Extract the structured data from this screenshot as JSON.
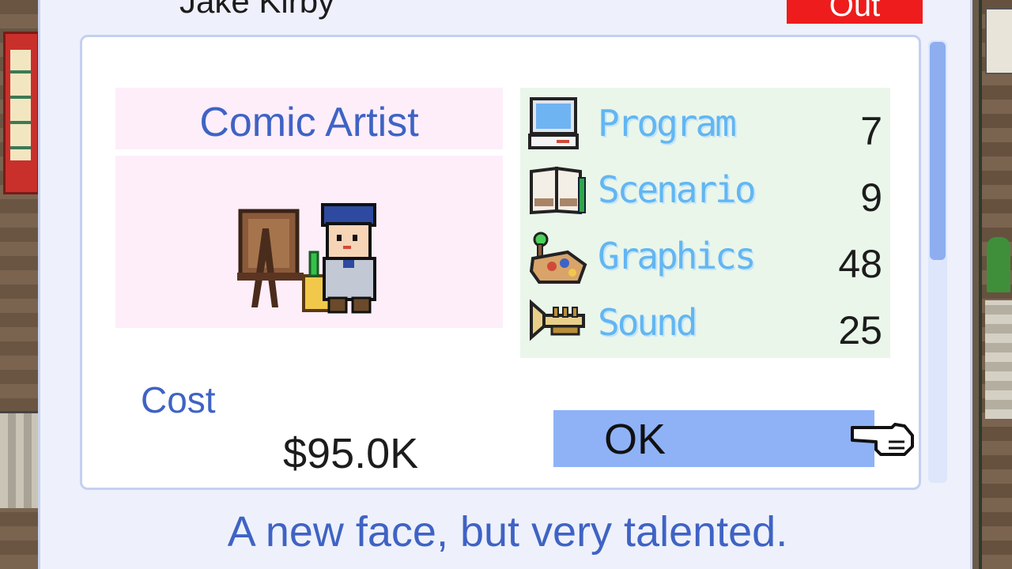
{
  "employee": {
    "name": "Jake Kirby",
    "out_label": "Out"
  },
  "job": {
    "title": "Comic Artist",
    "portrait": "comic-artist-sprite"
  },
  "stats": [
    {
      "label": "Program",
      "value": "7",
      "icon": "computer-icon"
    },
    {
      "label": "Scenario",
      "value": "9",
      "icon": "book-icon"
    },
    {
      "label": "Graphics",
      "value": "48",
      "icon": "palette-icon"
    },
    {
      "label": "Sound",
      "value": "25",
      "icon": "trumpet-icon"
    }
  ],
  "cost": {
    "label": "Cost",
    "value": "$95.0K"
  },
  "ok_label": "OK",
  "message": "A new face, but very talented.",
  "colors": {
    "out": "#ee1c1c",
    "ok": "#8fb2f7",
    "accent_text": "#3f63c4",
    "stat_label": "#62b6f2",
    "portrait_bg": "#fdeefa",
    "stats_bg": "#eaf6ea"
  }
}
